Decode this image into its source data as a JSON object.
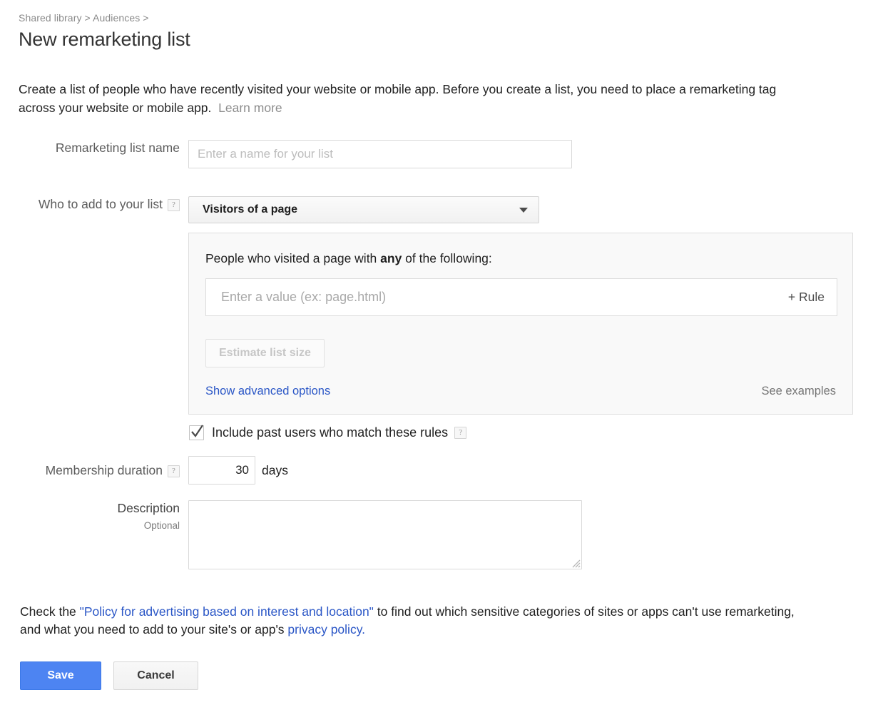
{
  "header": {
    "breadcrumb": "Shared library > Audiences >",
    "title": "New remarketing list"
  },
  "intro": {
    "text": "Create a list of people who have recently visited your website or mobile app. Before you create a list, you need to place a remarketing tag across your website or mobile app.",
    "learn_more": "Learn more"
  },
  "form": {
    "name_label": "Remarketing list name",
    "name_value": "",
    "name_placeholder": "Enter a name for your list",
    "who_label": "Who to add to your list",
    "who_help": "?",
    "who_selected": "Visitors of a page",
    "duration_label": "Membership duration",
    "duration_help": "?",
    "duration_value": "30",
    "duration_unit": "days",
    "description_label": "Description",
    "description_sub": "Optional",
    "description_value": ""
  },
  "rules": {
    "heading_prefix": "People who visited a page with ",
    "heading_bold": "any",
    "heading_suffix": " of the following:",
    "rule_value": "",
    "rule_placeholder": "Enter a value (ex: page.html)",
    "add_rule_label": "+ Rule",
    "estimate_label": "Estimate list size",
    "advanced_link": "Show advanced options",
    "examples_link": "See examples"
  },
  "include_past": {
    "label": "Include past users who match these rules",
    "help": "?",
    "checked": true
  },
  "policy": {
    "prefix": "Check the ",
    "link1": "\"Policy for advertising based on interest and location\"",
    "middle": " to find out which sensitive categories of sites or apps can't use remarketing, and what you need to add to your site's or app's ",
    "link2": "privacy policy.",
    "suffix": ""
  },
  "actions": {
    "save_label": "Save",
    "cancel_label": "Cancel"
  },
  "colors": {
    "accent_blue": "#4d84f2",
    "link_blue": "#2a56c6",
    "panel_bg": "#f9f9f9",
    "muted_text": "#8a8a8a"
  }
}
